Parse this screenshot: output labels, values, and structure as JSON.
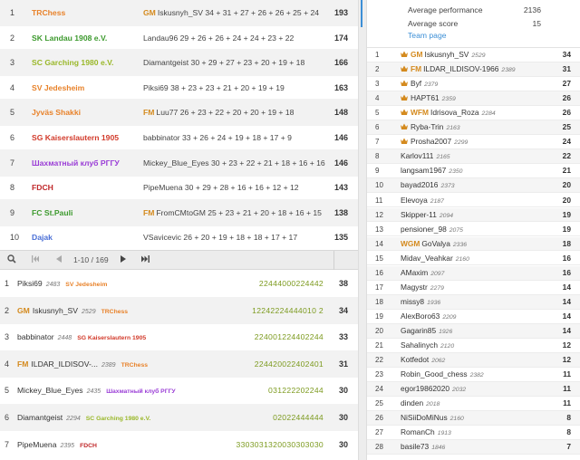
{
  "teams": [
    {
      "rank": "1",
      "name": "TRChess",
      "color": "#e8822a",
      "title": "GM",
      "player": "Iskusnyh_SV",
      "points": "34 + 31 + 27 + 26 + 26 + 25 + 24",
      "score": "193"
    },
    {
      "rank": "2",
      "name": "SK Landau 1908 e.V.",
      "color": "#3d9a2e",
      "title": "",
      "player": "Landau96",
      "points": "29 + 26 + 26 + 24 + 24 + 23 + 22",
      "score": "174"
    },
    {
      "rank": "3",
      "name": "SC Garching 1980 e.V.",
      "color": "#9ab82a",
      "title": "",
      "player": "Diamantgeist",
      "points": "30 + 29 + 27 + 23 + 20 + 19 + 18",
      "score": "166"
    },
    {
      "rank": "4",
      "name": "SV Jedesheim",
      "color": "#e8822a",
      "title": "",
      "player": "Piksi69",
      "points": "38 + 23 + 23 + 21 + 20 + 19 + 19",
      "score": "163"
    },
    {
      "rank": "5",
      "name": "Jyväs Shakki",
      "color": "#e8822a",
      "title": "FM",
      "player": "Luu77",
      "points": "26 + 23 + 22 + 20 + 20 + 19 + 18",
      "score": "148"
    },
    {
      "rank": "6",
      "name": "SG Kaiserslautern 1905",
      "color": "#d23a2a",
      "title": "",
      "player": "babbinator",
      "points": "33 + 26 + 24 + 19 + 18 + 17 + 9",
      "score": "146"
    },
    {
      "rank": "7",
      "name": "Шахматный клуб РГГУ",
      "color": "#9a3dd6",
      "title": "",
      "player": "Mickey_Blue_Eyes",
      "points": "30 + 23 + 22 + 21 + 18 + 16 + 16",
      "score": "146"
    },
    {
      "rank": "8",
      "name": "FDCH",
      "color": "#c0282a",
      "title": "",
      "player": "PipeMuena",
      "points": "30 + 29 + 28 + 16 + 16 + 12 + 12",
      "score": "143"
    },
    {
      "rank": "9",
      "name": "FC St.Pauli",
      "color": "#3d9a2e",
      "title": "FM",
      "player": "FromCMtoGM",
      "points": "25 + 23 + 21 + 20 + 18 + 16 + 15",
      "score": "138"
    },
    {
      "rank": "10",
      "name": "Dajak",
      "color": "#4a6fd6",
      "title": "",
      "player": "VSavicevic",
      "points": "26 + 20 + 19 + 18 + 18 + 17 + 17",
      "score": "135"
    }
  ],
  "pager": {
    "info": "1-10 / 169"
  },
  "players": [
    {
      "rank": "1",
      "title": "",
      "name": "Piksi69",
      "rating": "2483",
      "team": "SV Jedesheim",
      "teamColor": "#e8822a",
      "seq": "22444000224442",
      "score": "38"
    },
    {
      "rank": "2",
      "title": "GM",
      "name": "Iskusnyh_SV",
      "rating": "2529",
      "team": "TRChess",
      "teamColor": "#e8822a",
      "seq": "12242224444010 2",
      "score": "34"
    },
    {
      "rank": "3",
      "title": "",
      "name": "babbinator",
      "rating": "2448",
      "team": "SG Kaiserslautern 1905",
      "teamColor": "#d23a2a",
      "seq": "224001224402244",
      "score": "33"
    },
    {
      "rank": "4",
      "title": "FM",
      "name": "ILDAR_ILDISOV-...",
      "rating": "2389",
      "team": "TRChess",
      "teamColor": "#e8822a",
      "seq": "224420022402401",
      "score": "31"
    },
    {
      "rank": "5",
      "title": "",
      "name": "Mickey_Blue_Eyes",
      "rating": "2435",
      "team": "Шахматный клуб РГГУ",
      "teamColor": "#9a3dd6",
      "seq": "031222202244",
      "score": "30"
    },
    {
      "rank": "6",
      "title": "",
      "name": "Diamantgeist",
      "rating": "2294",
      "team": "SC Garching 1980 e.V.",
      "teamColor": "#9ab82a",
      "seq": "02022444444",
      "score": "30"
    },
    {
      "rank": "7",
      "title": "",
      "name": "PipeMuena",
      "rating": "2395",
      "team": "FDCH",
      "teamColor": "#c0282a",
      "seq": "3303031320030303030",
      "score": "30"
    }
  ],
  "stats": {
    "perf_label": "Average performance",
    "perf_value": "2136",
    "score_label": "Average score",
    "score_value": "15",
    "team_page": "Team page"
  },
  "roster": [
    {
      "rank": "1",
      "crown": true,
      "title": "GM",
      "name": "Iskusnyh_SV",
      "rating": "2529",
      "score": "34"
    },
    {
      "rank": "2",
      "crown": true,
      "title": "FM",
      "name": "ILDAR_ILDISOV-1966",
      "rating": "2389",
      "score": "31"
    },
    {
      "rank": "3",
      "crown": true,
      "title": "",
      "name": "Byf",
      "rating": "2379",
      "score": "27"
    },
    {
      "rank": "4",
      "crown": true,
      "title": "",
      "name": "HAPT61",
      "rating": "2359",
      "score": "26"
    },
    {
      "rank": "5",
      "crown": true,
      "title": "WFM",
      "name": "Idrisova_Roza",
      "rating": "2284",
      "score": "26"
    },
    {
      "rank": "6",
      "crown": true,
      "title": "",
      "name": "Ryba-Trin",
      "rating": "2163",
      "score": "25"
    },
    {
      "rank": "7",
      "crown": true,
      "title": "",
      "name": "Prosha2007",
      "rating": "2299",
      "score": "24"
    },
    {
      "rank": "8",
      "crown": false,
      "title": "",
      "name": "Karlov111",
      "rating": "2165",
      "score": "22"
    },
    {
      "rank": "9",
      "crown": false,
      "title": "",
      "name": "langsam1967",
      "rating": "2350",
      "score": "21"
    },
    {
      "rank": "10",
      "crown": false,
      "title": "",
      "name": "bayad2016",
      "rating": "2373",
      "score": "20"
    },
    {
      "rank": "11",
      "crown": false,
      "title": "",
      "name": "Elevoya",
      "rating": "2187",
      "score": "20"
    },
    {
      "rank": "12",
      "crown": false,
      "title": "",
      "name": "Skipper-11",
      "rating": "2094",
      "score": "19"
    },
    {
      "rank": "13",
      "crown": false,
      "title": "",
      "name": "pensioner_98",
      "rating": "2075",
      "score": "19"
    },
    {
      "rank": "14",
      "crown": false,
      "title": "WGM",
      "name": "GoValya",
      "rating": "2336",
      "score": "18"
    },
    {
      "rank": "15",
      "crown": false,
      "title": "",
      "name": "Midav_Veahkar",
      "rating": "2160",
      "score": "16"
    },
    {
      "rank": "16",
      "crown": false,
      "title": "",
      "name": "AMaxim",
      "rating": "2097",
      "score": "16"
    },
    {
      "rank": "17",
      "crown": false,
      "title": "",
      "name": "Magystr",
      "rating": "2279",
      "score": "14"
    },
    {
      "rank": "18",
      "crown": false,
      "title": "",
      "name": "missy8",
      "rating": "1936",
      "score": "14"
    },
    {
      "rank": "19",
      "crown": false,
      "title": "",
      "name": "AlexBoro63",
      "rating": "2209",
      "score": "14"
    },
    {
      "rank": "20",
      "crown": false,
      "title": "",
      "name": "Gagarin85",
      "rating": "1926",
      "score": "14"
    },
    {
      "rank": "21",
      "crown": false,
      "title": "",
      "name": "Sahalinych",
      "rating": "2120",
      "score": "12"
    },
    {
      "rank": "22",
      "crown": false,
      "title": "",
      "name": "Kotfedot",
      "rating": "2062",
      "score": "12"
    },
    {
      "rank": "23",
      "crown": false,
      "title": "",
      "name": "Robin_Good_chess",
      "rating": "2382",
      "score": "11"
    },
    {
      "rank": "24",
      "crown": false,
      "title": "",
      "name": "egor19862020",
      "rating": "2032",
      "score": "11"
    },
    {
      "rank": "25",
      "crown": false,
      "title": "",
      "name": "dinden",
      "rating": "2018",
      "score": "11"
    },
    {
      "rank": "26",
      "crown": false,
      "title": "",
      "name": "NiSiiDoMiNus",
      "rating": "2160",
      "score": "8"
    },
    {
      "rank": "27",
      "crown": false,
      "title": "",
      "name": "RomanCh",
      "rating": "1913",
      "score": "8"
    },
    {
      "rank": "28",
      "crown": false,
      "title": "",
      "name": "basile73",
      "rating": "1846",
      "score": "7"
    }
  ],
  "icons": {
    "search": "search-icon",
    "first": "first-page-icon",
    "prev": "prev-page-icon",
    "next": "next-page-icon",
    "last": "last-page-icon",
    "crown": "crown-icon"
  },
  "colors": {
    "accent": "#3c8fd6",
    "title": "#d48a1e",
    "sequence": "#7c9a1e"
  }
}
